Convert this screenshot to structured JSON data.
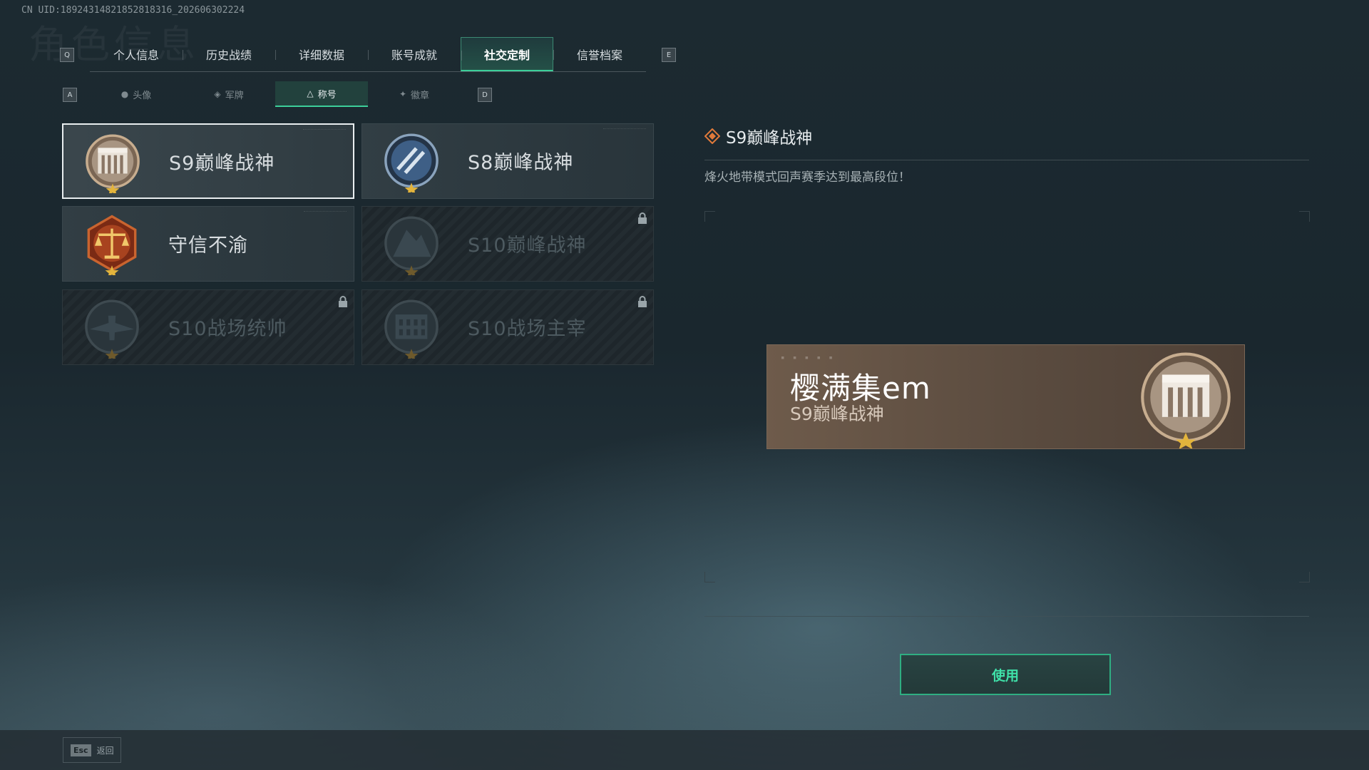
{
  "uid_text": "CN UID:18924314821852818316_202606302224",
  "ghost_title": "角色信息",
  "top_nav": {
    "left_key": "Q",
    "right_key": "E",
    "tabs": [
      {
        "label": "个人信息"
      },
      {
        "label": "历史战绩"
      },
      {
        "label": "详细数据"
      },
      {
        "label": "账号成就"
      },
      {
        "label": "社交定制",
        "active": true
      },
      {
        "label": "信誉档案"
      }
    ]
  },
  "sub_nav": {
    "left_key": "A",
    "right_key": "D",
    "tabs": [
      {
        "label": "头像",
        "icon": "person-icon"
      },
      {
        "label": "军牌",
        "icon": "dogtag-icon"
      },
      {
        "label": "称号",
        "icon": "triangle-icon",
        "active": true
      },
      {
        "label": "徽章",
        "icon": "wings-icon"
      }
    ]
  },
  "titles": [
    {
      "label": "S9巅峰战神",
      "badge": "fortress-badge",
      "state": "selected"
    },
    {
      "label": "S8巅峰战神",
      "badge": "blue-stripe-badge",
      "state": "unlocked"
    },
    {
      "label": "守信不渝",
      "badge": "scales-badge",
      "state": "unlocked"
    },
    {
      "label": "S10巅峰战神",
      "badge": "mountain-badge",
      "state": "locked"
    },
    {
      "label": "S10战场统帅",
      "badge": "aircraft-badge",
      "state": "locked"
    },
    {
      "label": "S10战场主宰",
      "badge": "colosseum-badge",
      "state": "locked"
    }
  ],
  "detail": {
    "title": "S9巅峰战神",
    "description": "烽火地带模式回声赛季达到最高段位！"
  },
  "preview": {
    "player_name": "樱满集em",
    "title": "S9巅峰战神"
  },
  "use_button": "使用",
  "footer": {
    "esc_key": "Esc",
    "back_label": "返回"
  },
  "colors": {
    "accent": "#3ccf9a",
    "gold": "#e3b43c",
    "detail_icon": "#e07a3a"
  }
}
